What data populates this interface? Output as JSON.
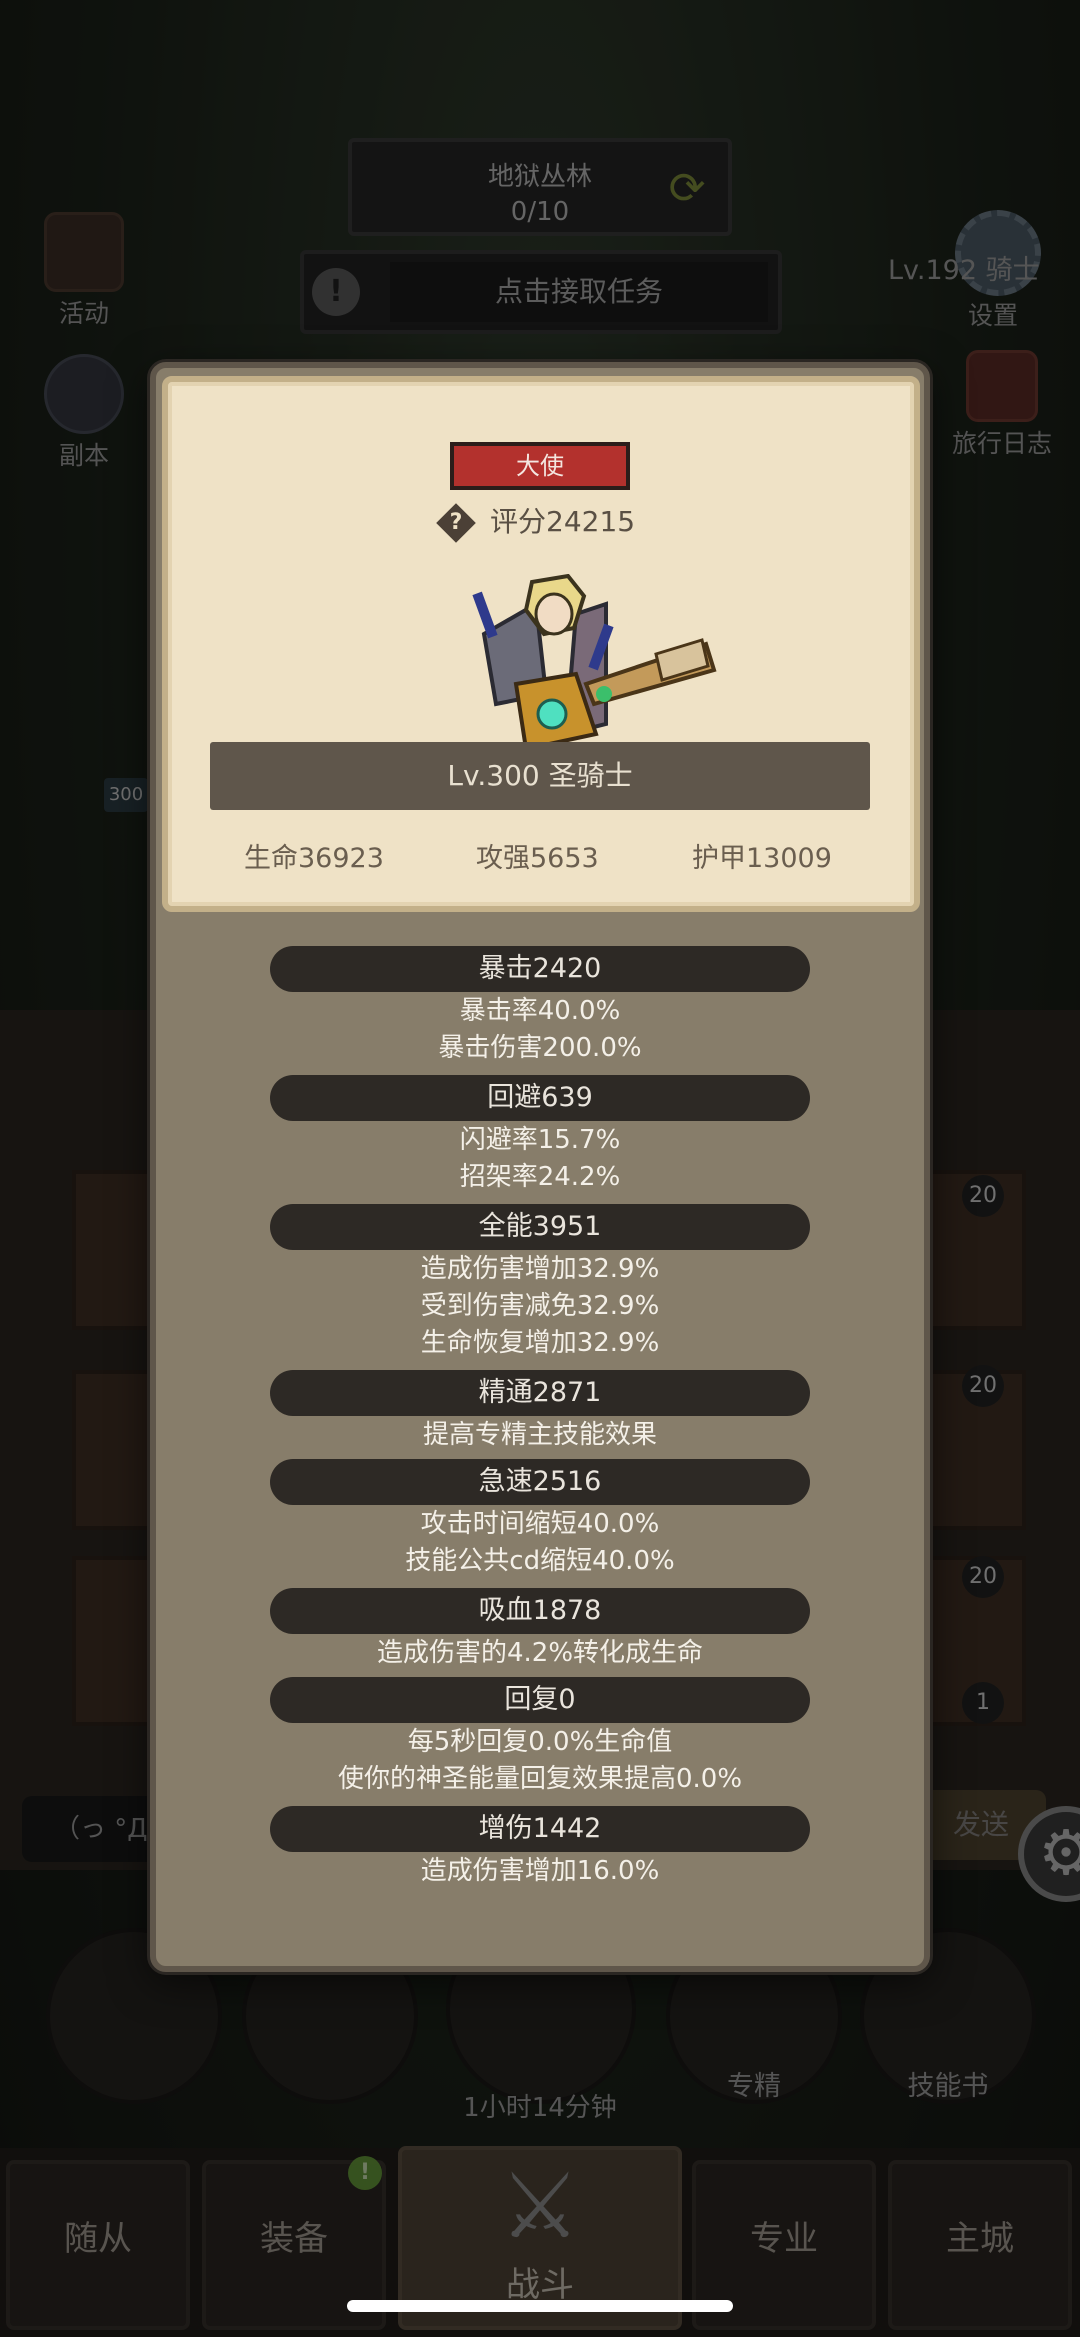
{
  "background": {
    "quest": {
      "title": "地狱丛林",
      "progress": "0/10"
    },
    "accept_task": "点击接取任务",
    "left_icons": [
      {
        "label": "活动",
        "icon": "scroll-icon"
      },
      {
        "label": "副本",
        "icon": "portal-icon"
      }
    ],
    "right_icons": [
      {
        "label": "设置",
        "icon": "gear-icon"
      },
      {
        "label": "旅行日志",
        "icon": "journal-icon"
      }
    ],
    "player_level_label": "Lv.192 骑士",
    "side_badge": "300",
    "slot_badges": [
      "20",
      "20",
      "20",
      "1"
    ],
    "chat_preview": "（っ °Д °",
    "send_label": "发送",
    "round_buttons": [
      {
        "label": "",
        "icon": "potion-icon"
      },
      {
        "label": "",
        "icon": "bread-icon"
      },
      {
        "label": "",
        "icon": "chest-icon"
      },
      {
        "label": "专精",
        "icon": "specialty-icon"
      },
      {
        "label": "技能书",
        "icon": "skillbook-icon"
      }
    ],
    "idle_timer": "1小时14分钟"
  },
  "bottom_nav": {
    "tabs": [
      "随从",
      "装备",
      "战斗",
      "专业",
      "主城"
    ],
    "active": "战斗",
    "notification": "!"
  },
  "popup": {
    "class_badge": "大使",
    "score": "评分24215",
    "hero_name": "Lv.300 圣骑士",
    "base_stats": {
      "hp": "生命36923",
      "attack": "攻强5653",
      "armor": "护甲13009"
    },
    "sections": [
      {
        "header": "暴击2420",
        "lines": [
          "暴击率40.0%",
          "暴击伤害200.0%"
        ]
      },
      {
        "header": "回避639",
        "lines": [
          "闪避率15.7%",
          "招架率24.2%"
        ]
      },
      {
        "header": "全能3951",
        "lines": [
          "造成伤害增加32.9%",
          "受到伤害减免32.9%",
          "生命恢复增加32.9%"
        ]
      },
      {
        "header": "精通2871",
        "lines": [
          "提高专精主技能效果"
        ]
      },
      {
        "header": "急速2516",
        "lines": [
          "攻击时间缩短40.0%",
          "技能公共cd缩短40.0%"
        ]
      },
      {
        "header": "吸血1878",
        "lines": [
          "造成伤害的4.2%转化成生命"
        ]
      },
      {
        "header": "回复0",
        "lines": [
          "每5秒回复0.0%生命值",
          "使你的神圣能量回复效果提高0.0%"
        ]
      },
      {
        "header": "增伤1442",
        "lines": [
          "造成伤害增加16.0%"
        ]
      }
    ]
  },
  "colors": {
    "badge_red": "#b3312d",
    "card_parchment": "#efe2c6",
    "popup_panel": "#877d6a",
    "stat_header_bg": "#2d2925",
    "active_tab": "#4d4335"
  }
}
